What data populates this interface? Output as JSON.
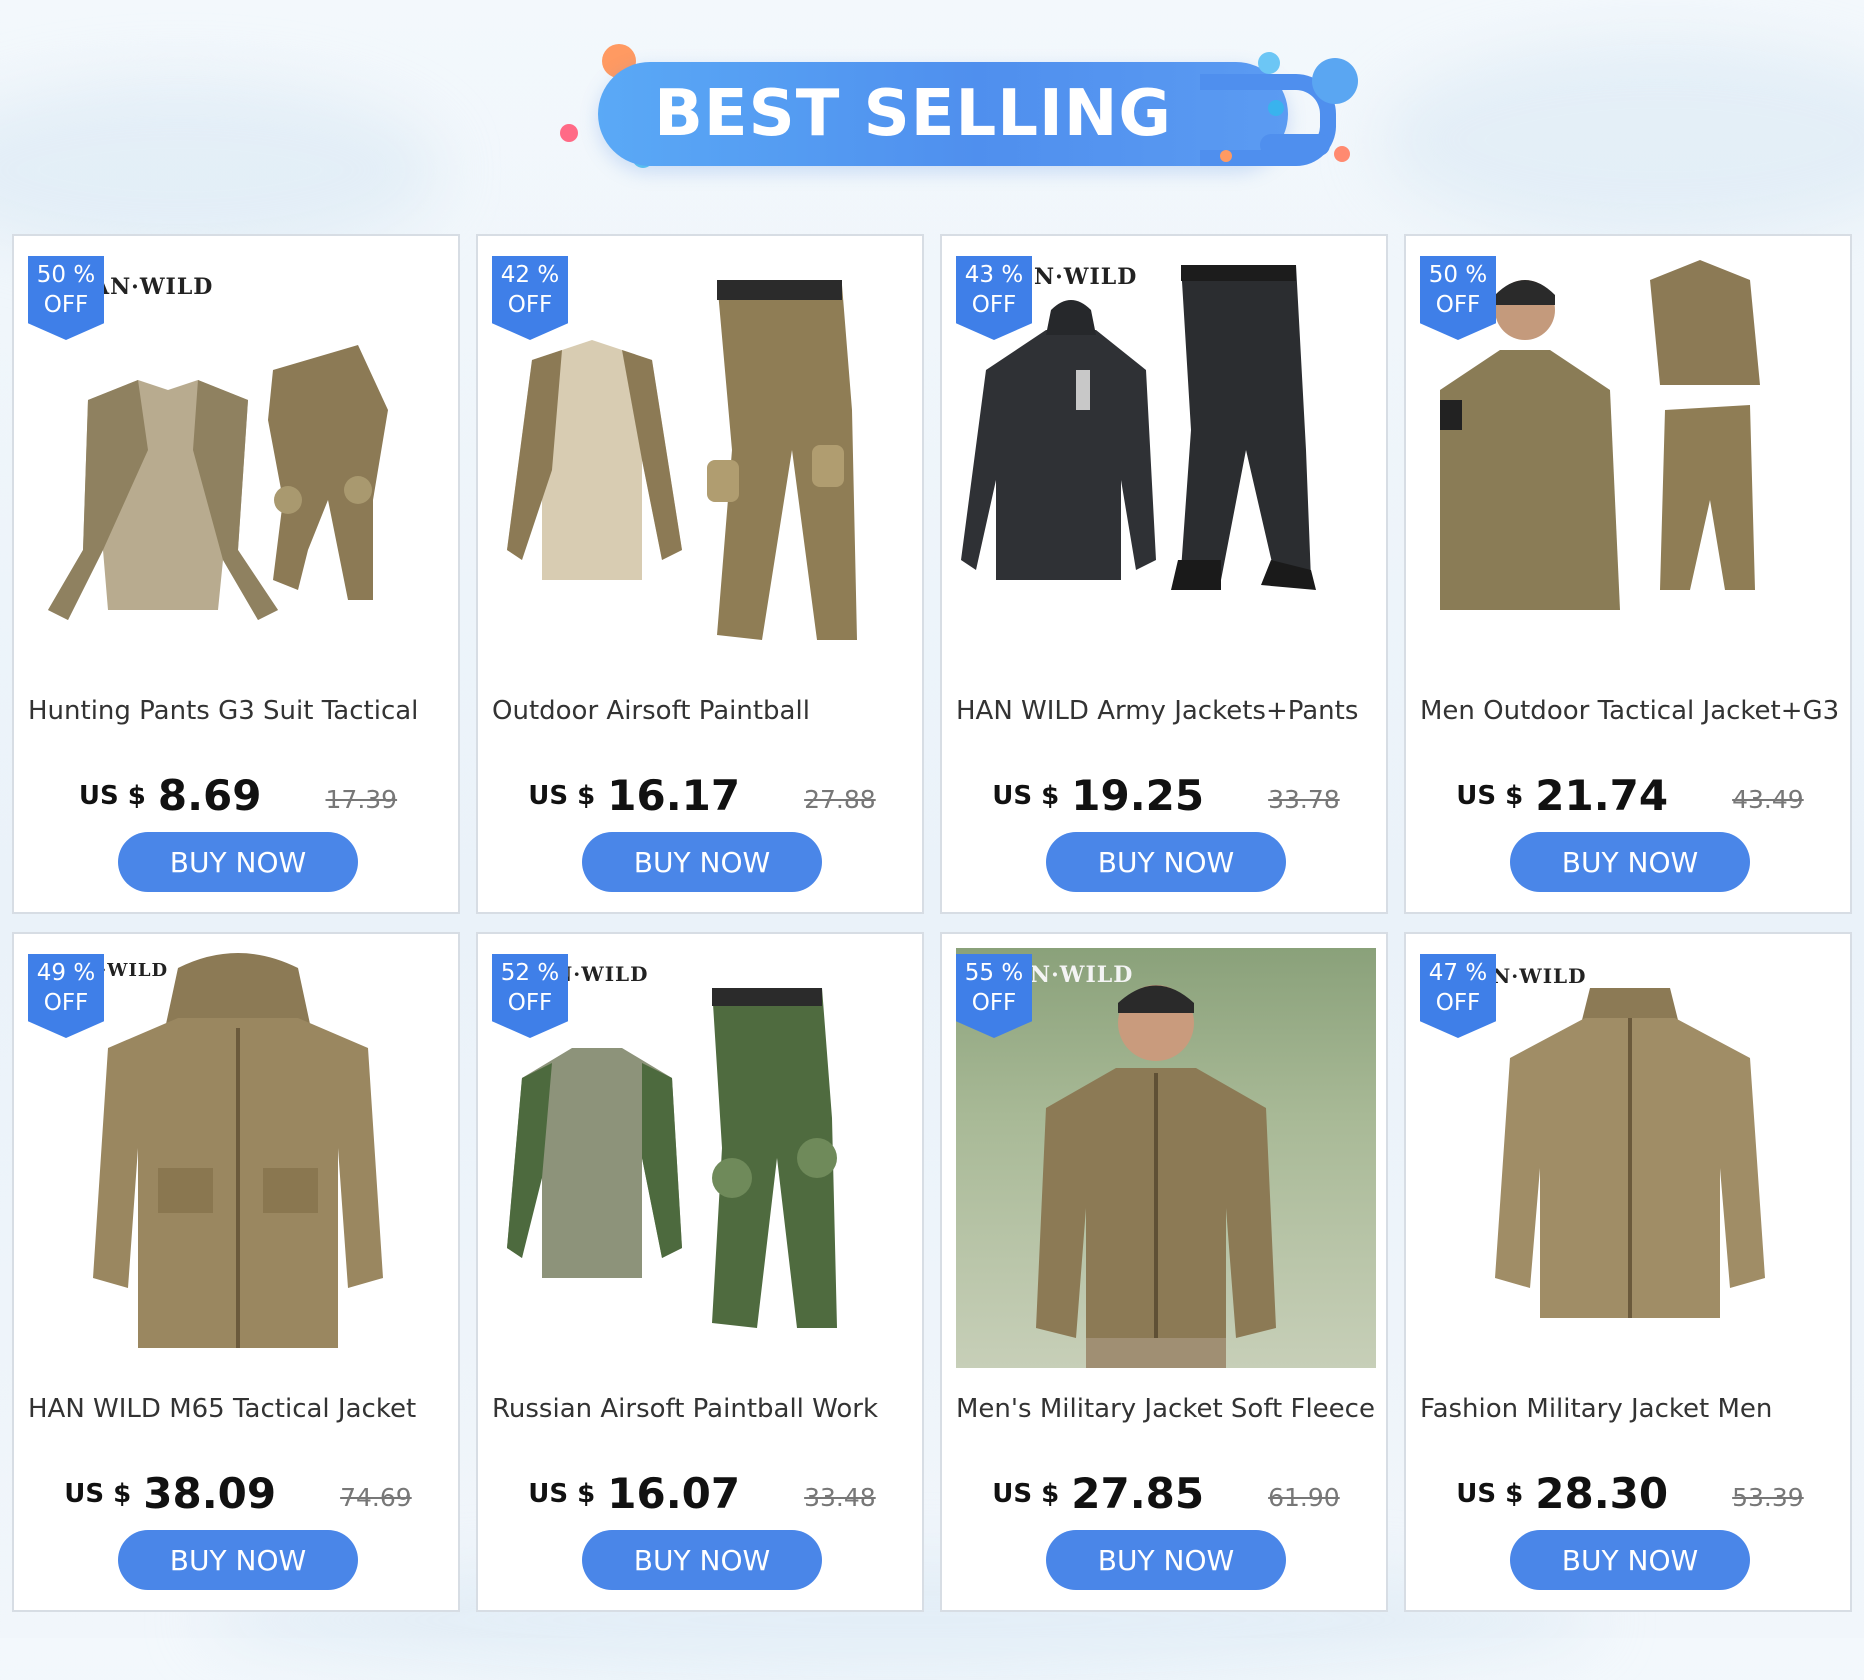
{
  "header": {
    "title": "BEST SELLING"
  },
  "currency": "US $",
  "buy_label": "BUY NOW",
  "products": [
    {
      "discount_pct": "50 %",
      "off": "OFF",
      "brand": "AN·WILD",
      "title": "Hunting Pants G3 Suit Tactical",
      "price": "8.69",
      "old_price": "17.39"
    },
    {
      "discount_pct": "42 %",
      "off": "OFF",
      "brand": "",
      "title": "Outdoor Airsoft Paintball",
      "price": "16.17",
      "old_price": "27.88"
    },
    {
      "discount_pct": "43 %",
      "off": "OFF",
      "brand": "N·WILD",
      "title": "HAN WILD Army Jackets+Pants",
      "price": "19.25",
      "old_price": "33.78"
    },
    {
      "discount_pct": "50 %",
      "off": "OFF",
      "brand": "",
      "title": "Men Outdoor Tactical Jacket+G3",
      "price": "21.74",
      "old_price": "43.49"
    },
    {
      "discount_pct": "49 %",
      "off": "OFF",
      "brand": "·WILD",
      "title": "HAN WILD M65 Tactical Jacket",
      "price": "38.09",
      "old_price": "74.69"
    },
    {
      "discount_pct": "52 %",
      "off": "OFF",
      "brand": "N·WILD",
      "title": "Russian Airsoft Paintball Work",
      "price": "16.07",
      "old_price": "33.48"
    },
    {
      "discount_pct": "55 %",
      "off": "OFF",
      "brand": "N·WILD",
      "title": "Men's Military Jacket Soft Fleece",
      "price": "27.85",
      "old_price": "61.90"
    },
    {
      "discount_pct": "47 %",
      "off": "OFF",
      "brand": "N·WILD",
      "title": "Fashion Military Jacket Men",
      "price": "28.30",
      "old_price": "53.39"
    }
  ],
  "colors": {
    "accent": "#4a86e8",
    "badge": "#3f7fe8",
    "banner": "#4f8fee",
    "camo_multicam": "#8c7a55",
    "camo_black": "#2b2d30",
    "camo_green": "#4d6a3e"
  }
}
